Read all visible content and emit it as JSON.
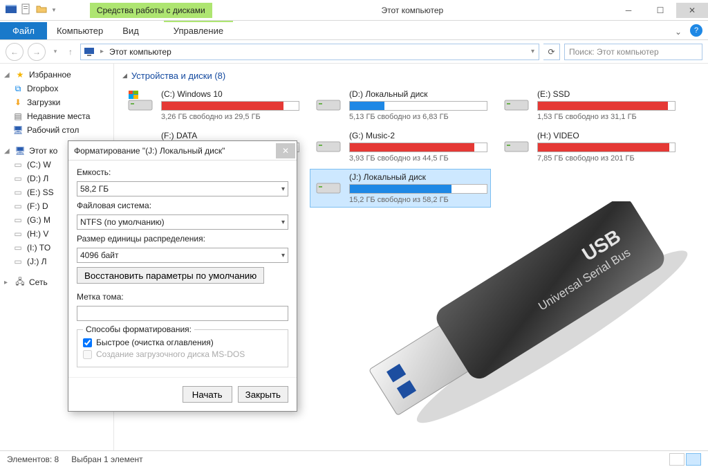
{
  "window": {
    "title": "Этот компьютер",
    "drive_tools_tab": "Средства работы с дисками"
  },
  "ribbon": {
    "file": "Файл",
    "computer": "Компьютер",
    "view": "Вид",
    "manage": "Управление"
  },
  "address": {
    "crumb": "Этот компьютер",
    "search_placeholder": "Поиск: Этот компьютер"
  },
  "sidebar": {
    "favorites": "Избранное",
    "fav_items": [
      {
        "label": "Dropbox"
      },
      {
        "label": "Загрузки"
      },
      {
        "label": "Недавние места"
      },
      {
        "label": "Рабочий стол"
      }
    ],
    "this_pc": "Этот ко",
    "pc_items": [
      {
        "label": "(C:) W"
      },
      {
        "label": "(D:) Л"
      },
      {
        "label": "(E:) SS"
      },
      {
        "label": "(F:) D"
      },
      {
        "label": "(G:) M"
      },
      {
        "label": "(H:) V"
      },
      {
        "label": "(I:) TO"
      },
      {
        "label": "(J:) Л"
      }
    ],
    "network": "Сеть"
  },
  "section": {
    "header": "Устройства и диски (8)"
  },
  "drives": [
    {
      "name": "(C:) Windows 10",
      "free": "3,26 ГБ свободно из 29,5 ГБ",
      "pct": 89,
      "color": "red",
      "os": true
    },
    {
      "name": "(D:) Локальный диск",
      "free": "5,13 ГБ свободно из 6,83 ГБ",
      "pct": 25,
      "color": "blue"
    },
    {
      "name": "(E:) SSD",
      "free": "1,53 ГБ свободно из 31,1 ГБ",
      "pct": 95,
      "color": "red"
    },
    {
      "name": "(F:) DATA",
      "free": "",
      "pct": 55,
      "color": "blue"
    },
    {
      "name": "(G:) Music-2",
      "free": "3,93 ГБ свободно из 44,5 ГБ",
      "pct": 91,
      "color": "red"
    },
    {
      "name": "(H:) VIDEO",
      "free": "7,85 ГБ свободно из 201 ГБ",
      "pct": 96,
      "color": "red"
    },
    {
      "name": "",
      "free": "",
      "pct": 0,
      "color": "blue",
      "hidden": true
    },
    {
      "name": "(J:) Локальный диск",
      "free": "15,2 ГБ свободно из 58,2 ГБ",
      "pct": 74,
      "color": "blue",
      "selected": true
    }
  ],
  "statusbar": {
    "count": "Элементов: 8",
    "selected": "Выбран 1 элемент"
  },
  "dialog": {
    "title": "Форматирование \"(J:) Локальный диск\"",
    "capacity_label": "Емкость:",
    "capacity_value": "58,2 ГБ",
    "fs_label": "Файловая система:",
    "fs_value": "NTFS (по умолчанию)",
    "alloc_label": "Размер единицы распределения:",
    "alloc_value": "4096 байт",
    "restore_btn": "Восстановить параметры по умолчанию",
    "volume_label": "Метка тома:",
    "volume_value": "",
    "options_legend": "Способы форматирования:",
    "quick_format": "Быстрое (очистка оглавления)",
    "msdos_boot": "Создание загрузочного диска MS-DOS",
    "start_btn": "Начать",
    "close_btn": "Закрыть"
  },
  "usb": {
    "title": "USB",
    "subtitle": "Universal Serial Bus"
  }
}
